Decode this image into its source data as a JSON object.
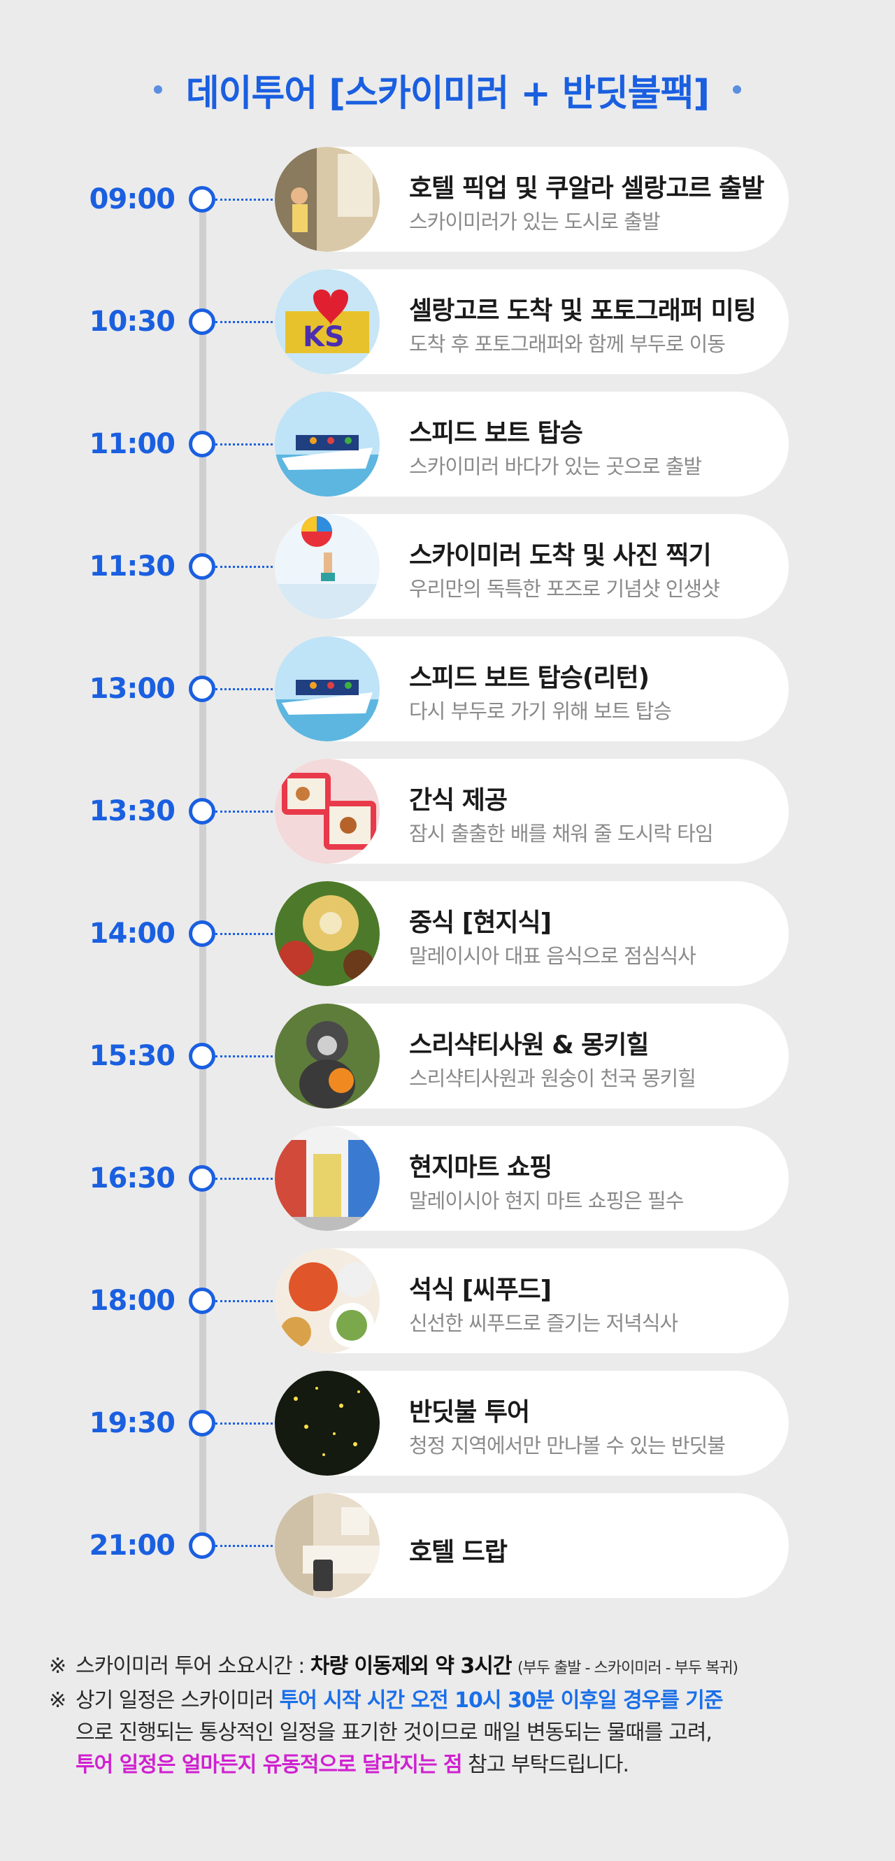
{
  "title": "데이투어 [스카이미러 + 반딧불팩]",
  "colors": {
    "accent": "#1a5fe0",
    "highlight_blue": "#1a6fe8",
    "highlight_pink": "#d020d0",
    "background": "#ebebeb"
  },
  "schedule": [
    {
      "time": "09:00",
      "title": "호텔 픽업 및 쿠알라 셀랑고르 출발",
      "subtitle": "스카이미러가 있는 도시로 출발",
      "image": "hotel-lobby-photo"
    },
    {
      "time": "10:30",
      "title": "셀랑고르 도착 및 포토그래퍼 미팅",
      "subtitle": "도착 후 포토그래퍼와 함께 부두로 이동",
      "image": "i-love-ks-sign-photo"
    },
    {
      "time": "11:00",
      "title": "스피드 보트 탑승",
      "subtitle": "스카이미러 바다가 있는 곳으로 출발",
      "image": "speed-boat-photo"
    },
    {
      "time": "11:30",
      "title": "스카이미러 도착 및 사진 찍기",
      "subtitle": "우리만의 독특한 포즈로 기념샷 인생샷",
      "image": "sky-mirror-jump-photo"
    },
    {
      "time": "13:00",
      "title": "스피드 보트 탑승(리턴)",
      "subtitle": "다시 부두로 가기 위해 보트 탑승",
      "image": "speed-boat-photo"
    },
    {
      "time": "13:30",
      "title": "간식 제공",
      "subtitle": "잠시 출출한 배를 채워 줄 도시락 타임",
      "image": "lunchbox-photo"
    },
    {
      "time": "14:00",
      "title": "중식 [현지식]",
      "subtitle": "말레이시아 대표 음식으로 점심식사",
      "image": "local-food-photo"
    },
    {
      "time": "15:30",
      "title": "스리샥티사원 & 몽키힐",
      "subtitle": "스리샥티사원과 원숭이 천국 몽키힐",
      "image": "monkey-photo"
    },
    {
      "time": "16:30",
      "title": "현지마트 쇼핑",
      "subtitle": "말레이시아 현지 마트 쇼핑은 필수",
      "image": "supermarket-photo"
    },
    {
      "time": "18:00",
      "title": "석식 [씨푸드]",
      "subtitle": "신선한 씨푸드로 즐기는 저녁식사",
      "image": "seafood-photo"
    },
    {
      "time": "19:30",
      "title": "반딧불 투어",
      "subtitle": "청정 지역에서만 만나볼 수 있는 반딧불",
      "image": "fireflies-photo"
    },
    {
      "time": "21:00",
      "title": "호텔 드랍",
      "subtitle": "",
      "image": "hotel-room-photo"
    }
  ],
  "notes": {
    "mark": "※",
    "line1_text": "스카이미러 투어 소요시간 : ",
    "line1_bold": "차량 이동제외 약 3시간",
    "line1_small": "(부두 출발 - 스카이미러 - 부두 복귀)",
    "line2_text": "상기 일정은 스카이미러 ",
    "line2_blue": "투어 시작 시간 오전 10시 30분 이후일 경우를 기준",
    "line3_text": "으로 진행되는 통상적인 일정을 표기한 것이므로 매일 변동되는 물때를 고려,",
    "line4_pink": "투어 일정은 얼마든지 유동적으로 달라지는 점",
    "line4_text": " 참고 부탁드립니다."
  }
}
